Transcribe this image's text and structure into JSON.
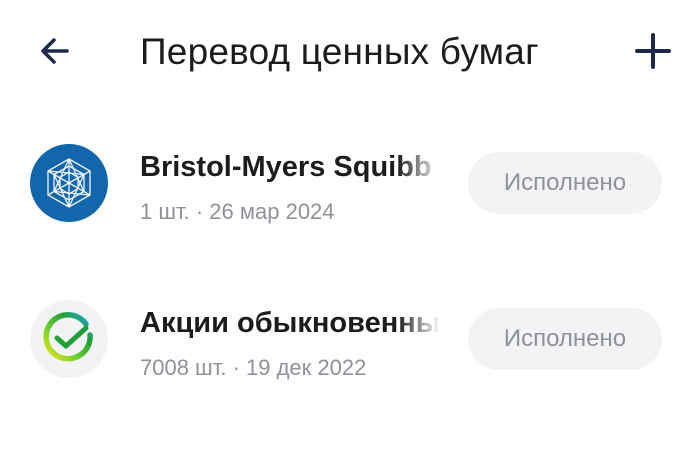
{
  "header": {
    "title": "Перевод ценных бумаг",
    "back_icon": "arrow-left-icon",
    "add_icon": "plus-icon",
    "icon_color": "#1d2a4a"
  },
  "items": [
    {
      "name": "Bristol-Myers Squibb",
      "meta": "1 шт. · 26 мар 2024",
      "status": "Исполнено",
      "logo_icon": "bristol-myers-squibb-logo",
      "logo_color": "#1266ab"
    },
    {
      "name": "Акции обыкновенные",
      "meta": "7008 шт. · 19 дек 2022",
      "status": "Исполнено",
      "logo_icon": "sber-logo",
      "logo_color": "#21a038"
    }
  ]
}
